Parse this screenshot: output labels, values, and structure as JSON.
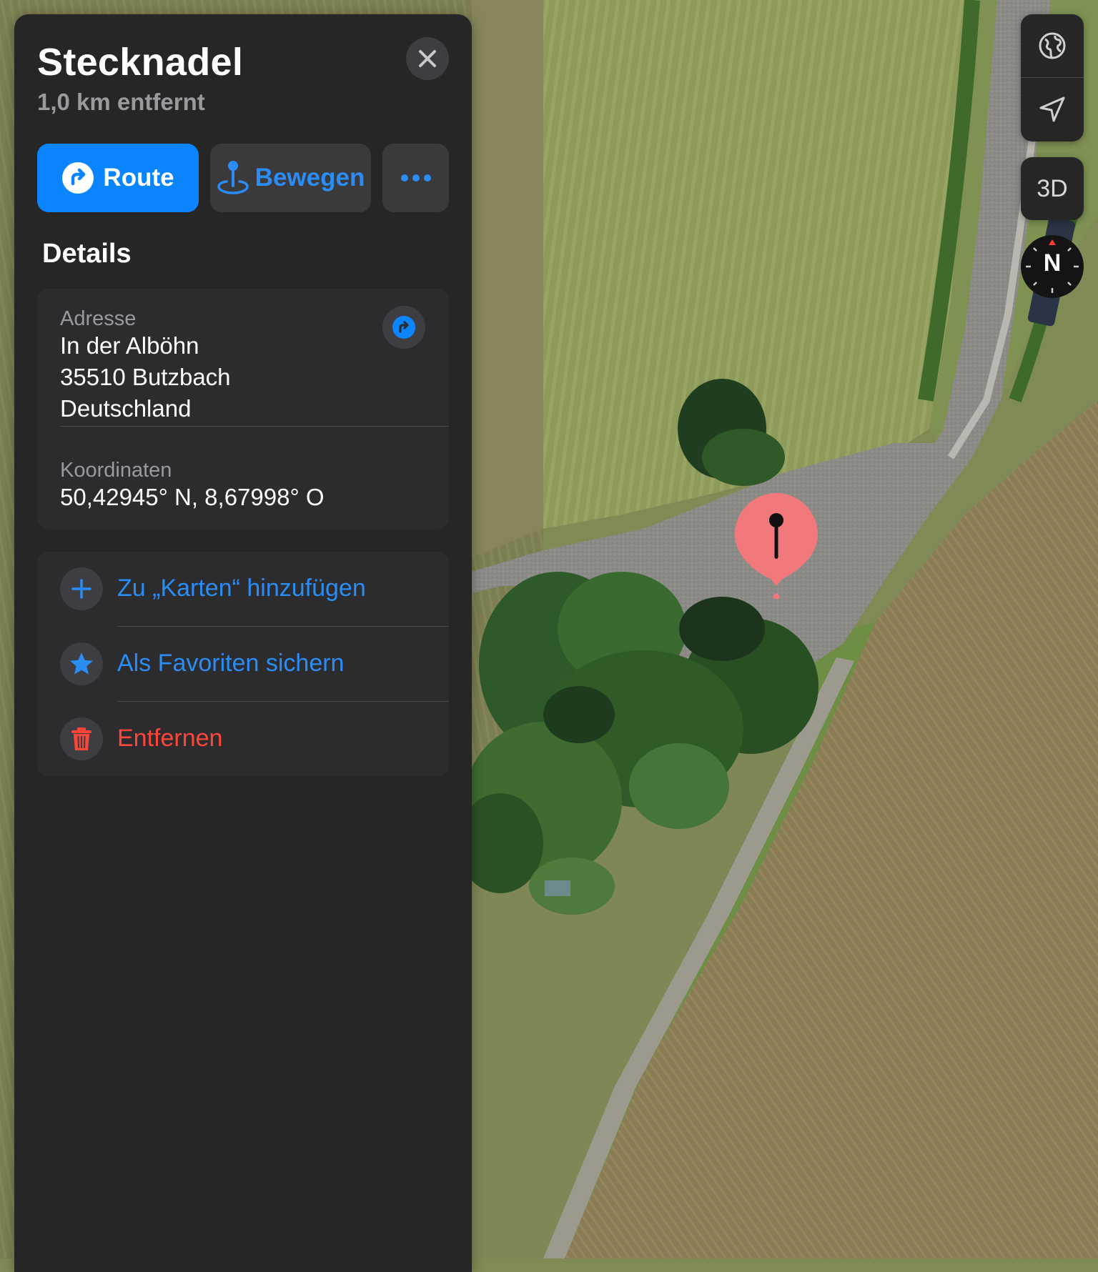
{
  "panel": {
    "title": "Stecknadel",
    "subtitle": "1,0 km entfernt",
    "buttons": {
      "route": "Route",
      "move": "Bewegen"
    },
    "details_heading": "Details",
    "address": {
      "label": "Adresse",
      "lines": [
        "In der Alböhn",
        "35510 Butzbach",
        "Deutschland"
      ]
    },
    "coordinates": {
      "label": "Koordinaten",
      "value": "50,42945° N, 8,67998° O"
    },
    "actions": [
      {
        "label": "Zu „Karten“ hinzufügen",
        "icon": "plus-icon",
        "color": "#2a8df5"
      },
      {
        "label": "Als Favoriten sichern",
        "icon": "star-icon",
        "color": "#2a8df5"
      },
      {
        "label": "Entfernen",
        "icon": "trash-icon",
        "color": "#ff453a"
      }
    ]
  },
  "map_controls": {
    "globe_icon": "globe-icon",
    "location_icon": "location-arrow-icon",
    "view_3d": "3D",
    "compass": "N"
  },
  "colors": {
    "accent": "#0a84ff",
    "destructive": "#ff453a",
    "pin": "#f2797b",
    "panel": "#262626",
    "card": "#2c2c2e"
  }
}
